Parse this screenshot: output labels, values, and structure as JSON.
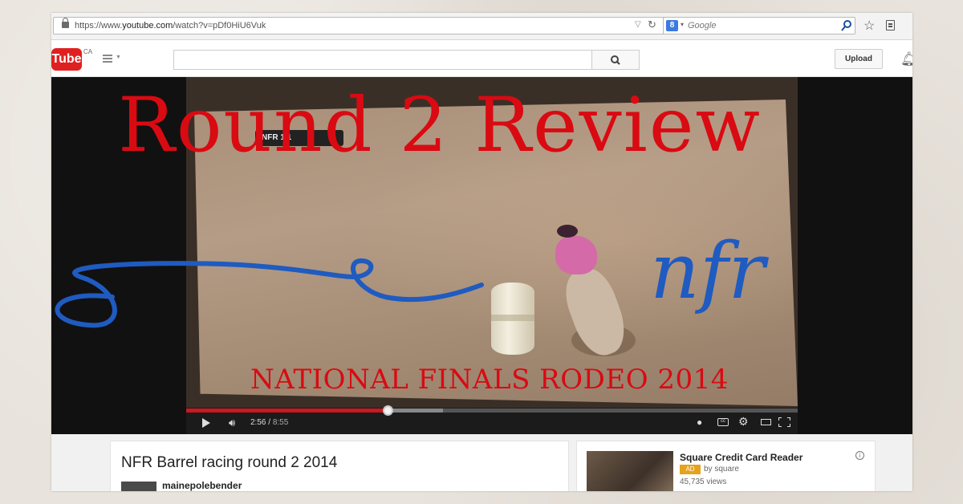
{
  "browser": {
    "url_prefix": "https://www.",
    "url_domain": "youtube.com",
    "url_path": "/watch?v=pDf0HiU6Vuk",
    "search_placeholder": "Google",
    "search_engine_letter": "8"
  },
  "youtube": {
    "logo_text": "Tube",
    "region": "CA",
    "search_value": "",
    "upload_label": "Upload"
  },
  "video": {
    "scoreboard_text": "NFR  1.1",
    "current_time": "2:56",
    "duration": "8:55",
    "progress": 0.33,
    "buffered": 0.42
  },
  "overlay": {
    "title": "Round 2 Review",
    "logo": "nfr",
    "subtitle": "NATIONAL FINALS RODEO 2014"
  },
  "info": {
    "video_title": "NFR Barrel racing round 2 2014",
    "channel": "mainepolebender"
  },
  "ad": {
    "title": "Square Credit Card Reader",
    "badge": "AD",
    "by": "by square",
    "views": "45,735 views"
  },
  "colors": {
    "title_red": "#d90a12",
    "nfr_blue": "#1f5bc0",
    "youtube_red": "#e02020",
    "progress_red": "#cc181e"
  }
}
